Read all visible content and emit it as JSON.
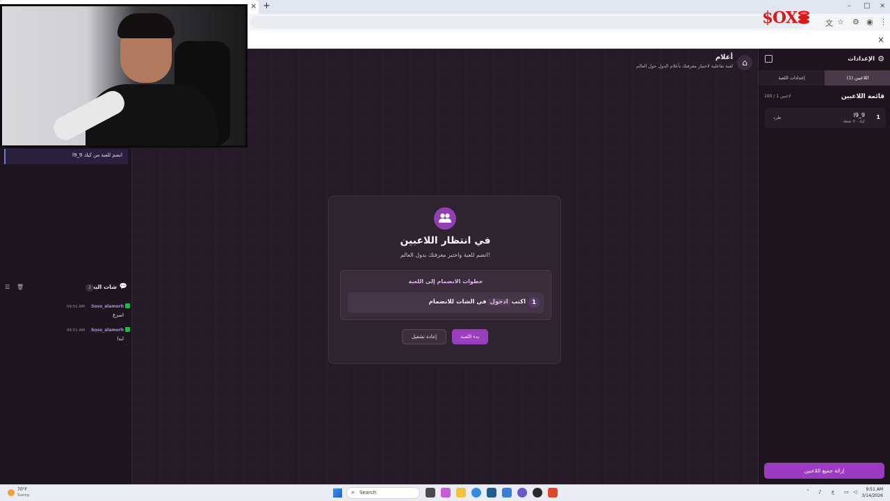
{
  "browser": {
    "tab_close": "×",
    "new_tab": "+",
    "bookmark_close": "×",
    "window_controls": [
      "–",
      "□",
      "×"
    ]
  },
  "logo": {
    "text": "$OX"
  },
  "chat_feed": {
    "join_message": "l9_9 انضم للعبة من كيك"
  },
  "chat": {
    "title": "شات البث",
    "count": "2",
    "messages": [
      {
        "user": "Soso_alamorh",
        "time": "09:51 AM",
        "text": "اسرع"
      },
      {
        "user": "Soso_alamorh",
        "time": "09:51 AM",
        "text": "ابدا"
      }
    ]
  },
  "header": {
    "title": "أعلام",
    "subtitle": "لعبة تفاعلية لاختبار معرفتك بأعلام الدول حول العالم"
  },
  "waiting_card": {
    "title": "في انتظار اللاعبين",
    "subtitle": "انضم للعبة واختبر معرفتك بدول العالم!",
    "steps_title": "خطوات الانضمام إلى اللعبة",
    "step_number": "1",
    "step_prefix": "اكتب",
    "step_keyword": "ادخول",
    "step_suffix": "في الشات للانضمام",
    "restart_label": "إعادة تشغيل",
    "start_label": "بدء اللعبة"
  },
  "settings": {
    "title": "الإعدادات",
    "tabs": [
      {
        "label": "اللاعبين (1)",
        "active": true
      },
      {
        "label": "إعدادات اللعبة",
        "active": false
      }
    ],
    "players_title": "قائمة اللاعبين",
    "players_count": "100 / 1 لاعبين",
    "players": [
      {
        "rank": "1",
        "name": "l9_9",
        "meta": "كيك · 0 نقطة",
        "kick_label": "طرد"
      }
    ],
    "remove_all_label": "إزالة جميع اللاعبين"
  },
  "taskbar": {
    "weather_temp": "70°F",
    "weather_condition": "Sunny",
    "search_placeholder": "Search",
    "time": "9:51 AM",
    "date": "3/14/2026"
  },
  "colors": {
    "accent": "#9b3fc1",
    "background": "#251926",
    "panel": "#1d141e",
    "badge_green": "#2bb24c"
  }
}
